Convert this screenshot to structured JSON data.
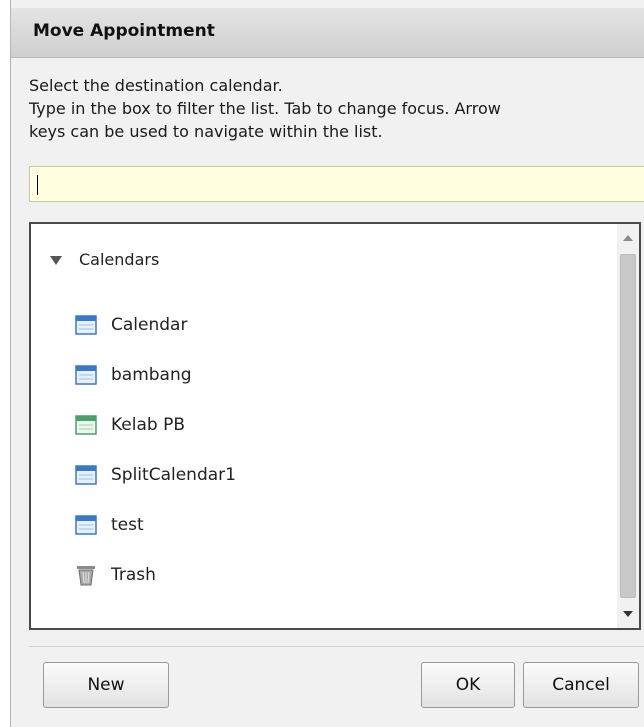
{
  "dialog": {
    "title": "Move Appointment",
    "instructions": [
      "Select the destination calendar.",
      "Type in the box to filter the list. Tab to change focus. Arrow",
      "keys can be used to navigate within the list."
    ],
    "filter": {
      "value": "",
      "placeholder": ""
    },
    "tree": {
      "root_label": "Calendars",
      "items": [
        {
          "label": "Calendar",
          "icon": "calendar-icon",
          "color": "#3a78c8"
        },
        {
          "label": "bambang",
          "icon": "calendar-icon",
          "color": "#3a78c8"
        },
        {
          "label": "Kelab PB",
          "icon": "calendar-icon",
          "color": "#4aa066"
        },
        {
          "label": "SplitCalendar1",
          "icon": "calendar-icon",
          "color": "#3a78c8"
        },
        {
          "label": "test",
          "icon": "calendar-icon",
          "color": "#3a78c8"
        },
        {
          "label": "Trash",
          "icon": "trash-icon",
          "color": "#7a7a7a"
        }
      ]
    },
    "buttons": {
      "new": "New",
      "ok": "OK",
      "cancel": "Cancel"
    }
  },
  "colors": {
    "title_bar": "#d7d7d7",
    "filter_background": "#ffffe0",
    "calendar_blue": "#3a78c8",
    "calendar_green": "#4aa066"
  }
}
